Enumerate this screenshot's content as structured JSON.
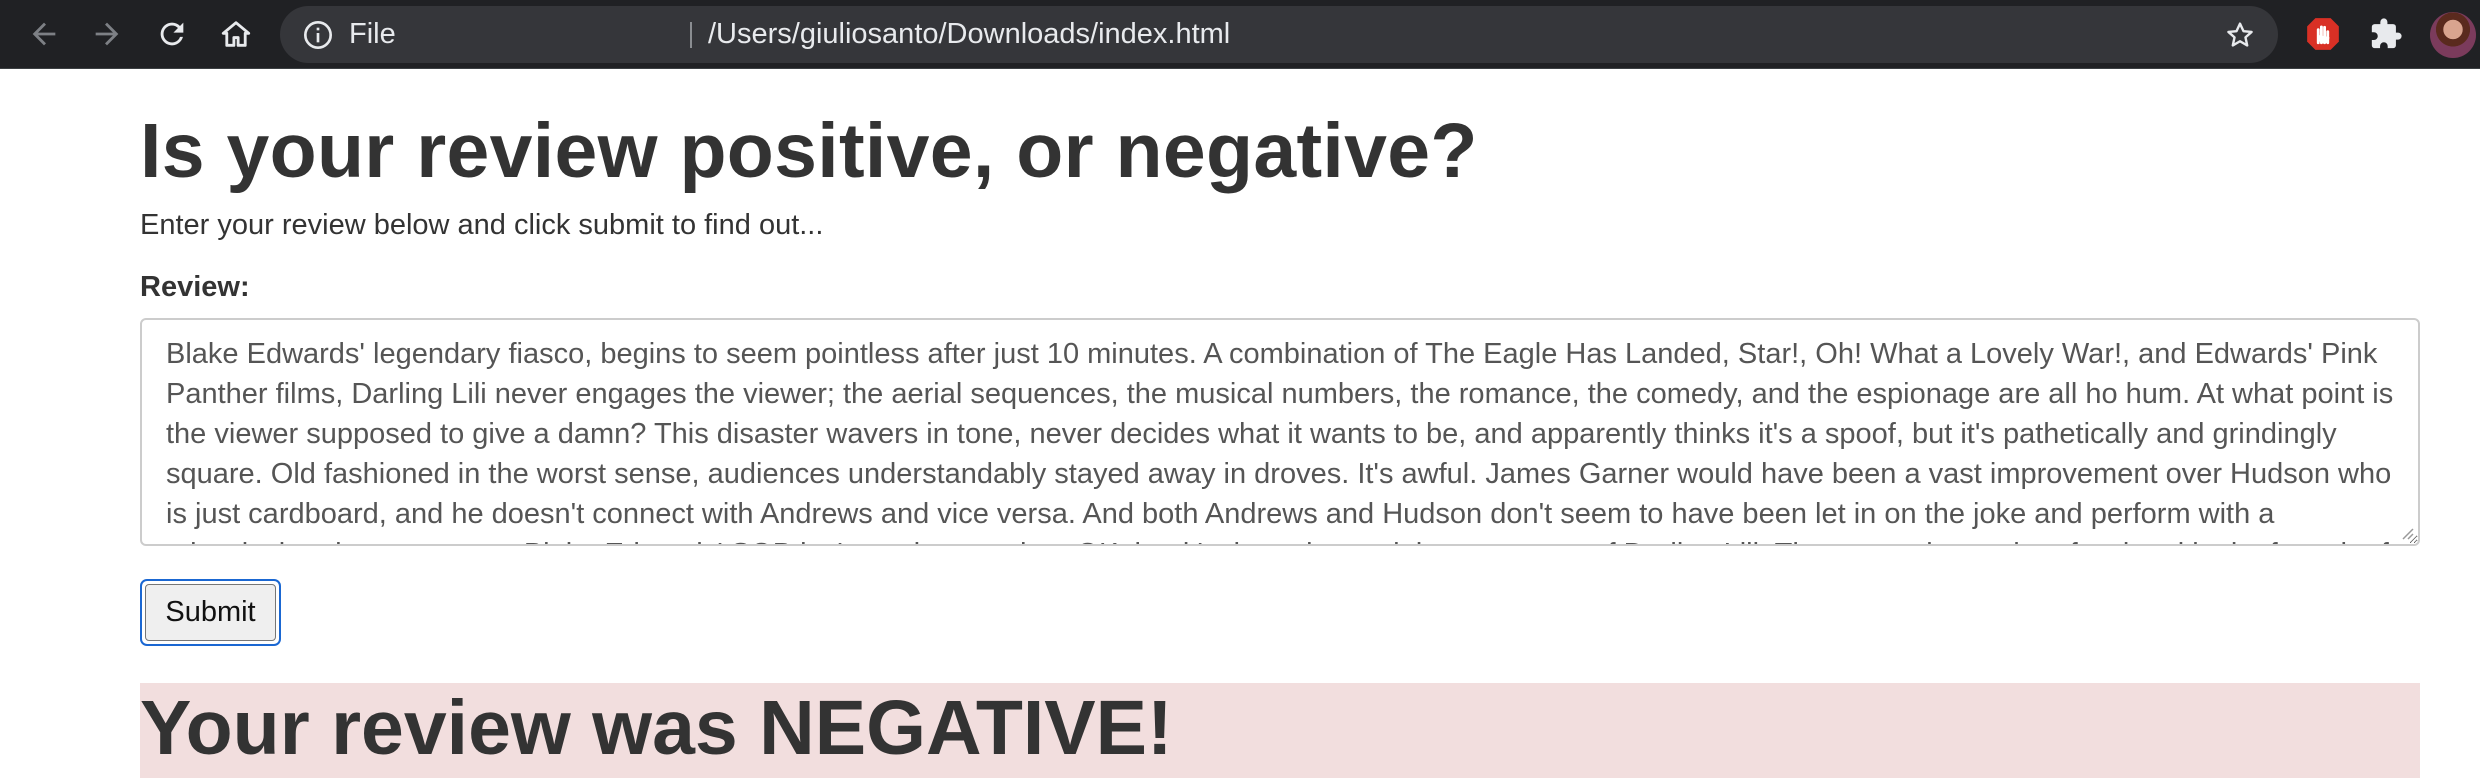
{
  "browser": {
    "address_scheme": "File",
    "address_url": "/Users/giuliosanto/Downloads/index.html",
    "icons": {
      "back": "back-arrow-icon",
      "forward": "forward-arrow-icon",
      "reload": "reload-icon",
      "home": "home-icon",
      "site_info": "info-icon",
      "bookmark": "star-icon",
      "extension_block": "stop-hand-icon",
      "extensions": "puzzle-icon"
    }
  },
  "page": {
    "title": "Is your review positive, or negative?",
    "instructions": "Enter your review below and click submit to find out...",
    "review_label": "Review:",
    "review_text": "Blake Edwards' legendary fiasco, begins to seem pointless after just 10 minutes. A combination of The Eagle Has Landed, Star!, Oh! What a Lovely War!, and Edwards' Pink Panther films, Darling Lili never engages the viewer; the aerial sequences, the musical numbers, the romance, the comedy, and the espionage are all ho hum. At what point is the viewer supposed to give a damn? This disaster wavers in tone, never decides what it wants to be, and apparently thinks it's a spoof, but it's pathetically and grindingly square. Old fashioned in the worst sense, audiences understandably stayed away in droves. It's awful. James Garner would have been a vast improvement over Hudson who is just cardboard, and he doesn't connect with Andrews and vice versa. And both Andrews and Hudson don't seem to have been let in on the joke and perform with a miscalculated earnestness. Blake Edwards' SOB isn't much more than OK, but it's the only good that came out of Darling Lili. The expensive and professional look of much of Darling Lili",
    "submit_label": "Submit",
    "result_text": "Your review was NEGATIVE!"
  },
  "colors": {
    "toolbar_bg": "#202124",
    "omnibox_bg": "#35363a",
    "result_negative_bg": "#f2dede",
    "extension_red": "#d93025",
    "focus_ring": "#1a67d2"
  }
}
